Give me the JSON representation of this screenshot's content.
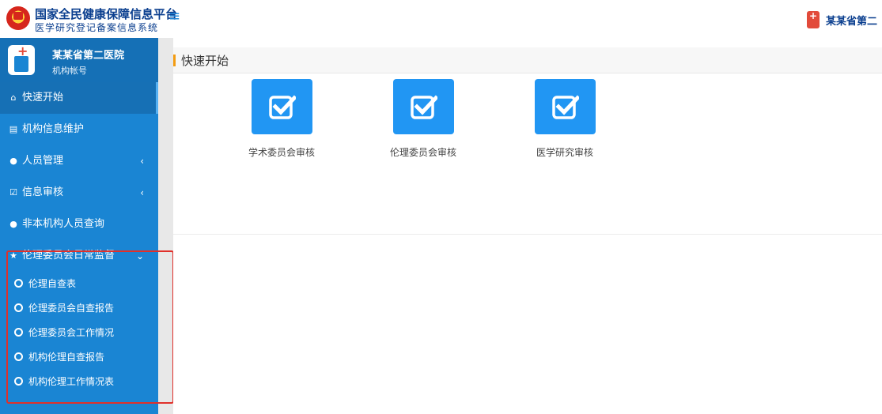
{
  "header": {
    "title": "国家全民健康保障信息平台",
    "subtitle": "医学研究登记备案信息系统",
    "user_name": "某某省第二"
  },
  "sidebar": {
    "profile": {
      "name": "某某省第二医院",
      "role": "机构帐号"
    },
    "items": [
      {
        "label": "快速开始",
        "icon": "home-icon"
      },
      {
        "label": "机构信息维护",
        "icon": "building-icon"
      },
      {
        "label": "人员管理",
        "icon": "users-icon"
      },
      {
        "label": "信息审核",
        "icon": "check-square-icon"
      },
      {
        "label": "非本机构人员查询",
        "icon": "users-icon"
      },
      {
        "label": "伦理委员会日常监督",
        "icon": "star-icon"
      }
    ],
    "subitems": [
      {
        "label": "伦理自查表"
      },
      {
        "label": "伦理委员会自查报告"
      },
      {
        "label": "伦理委员会工作情况"
      },
      {
        "label": "机构伦理自查报告"
      },
      {
        "label": "机构伦理工作情况表"
      }
    ]
  },
  "main": {
    "panel_title": "快速开始",
    "tiles": [
      {
        "label": "学术委员会审核"
      },
      {
        "label": "伦理委员会审核"
      },
      {
        "label": "医学研究审核"
      }
    ]
  },
  "colors": {
    "sidebar": "#1a85d3",
    "tile": "#2196f3",
    "accent": "#f39c12",
    "highlight": "#e0302a"
  }
}
